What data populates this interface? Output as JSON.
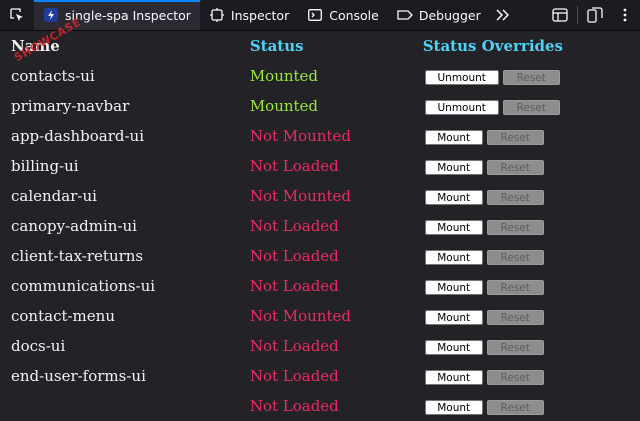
{
  "toolbar": {
    "pick_icon": "element-picker-icon",
    "tabs": [
      {
        "label": "single-spa Inspector",
        "icon": "single-spa-icon",
        "active": true
      },
      {
        "label": "Inspector",
        "icon": "inspector-icon"
      },
      {
        "label": "Console",
        "icon": "console-icon"
      },
      {
        "label": "Debugger",
        "icon": "debugger-icon"
      }
    ],
    "more_icon": "chevrons-right-icon",
    "right_icons": [
      "dock-layout-icon",
      "responsive-design-icon",
      "kebab-menu-icon"
    ]
  },
  "table": {
    "headers": {
      "name": "Name",
      "status": "Status",
      "overrides": "Status Overrides"
    },
    "rows": [
      {
        "name": "contacts-ui",
        "status": "Mounted",
        "action": "Unmount",
        "reset": "Reset"
      },
      {
        "name": "primary-navbar",
        "status": "Mounted",
        "action": "Unmount",
        "reset": "Reset"
      },
      {
        "name": "app-dashboard-ui",
        "status": "Not Mounted",
        "action": "Mount",
        "reset": "Reset"
      },
      {
        "name": "billing-ui",
        "status": "Not Loaded",
        "action": "Mount",
        "reset": "Reset"
      },
      {
        "name": "calendar-ui",
        "status": "Not Mounted",
        "action": "Mount",
        "reset": "Reset"
      },
      {
        "name": "canopy-admin-ui",
        "status": "Not Loaded",
        "action": "Mount",
        "reset": "Reset"
      },
      {
        "name": "client-tax-returns",
        "status": "Not Loaded",
        "action": "Mount",
        "reset": "Reset"
      },
      {
        "name": "communications-ui",
        "status": "Not Loaded",
        "action": "Mount",
        "reset": "Reset"
      },
      {
        "name": "contact-menu",
        "status": "Not Mounted",
        "action": "Mount",
        "reset": "Reset"
      },
      {
        "name": "docs-ui",
        "status": "Not Loaded",
        "action": "Mount",
        "reset": "Reset"
      },
      {
        "name": "end-user-forms-ui",
        "status": "Not Loaded",
        "action": "Mount",
        "reset": "Reset"
      },
      {
        "name": "",
        "status": "Not Loaded",
        "action": "Mount",
        "reset": "Reset"
      }
    ]
  },
  "colors": {
    "header": "#4fd2f6",
    "mounted": "#9ce63a",
    "not_mounted": "#ea2a64",
    "accent": "#0a84ff"
  }
}
